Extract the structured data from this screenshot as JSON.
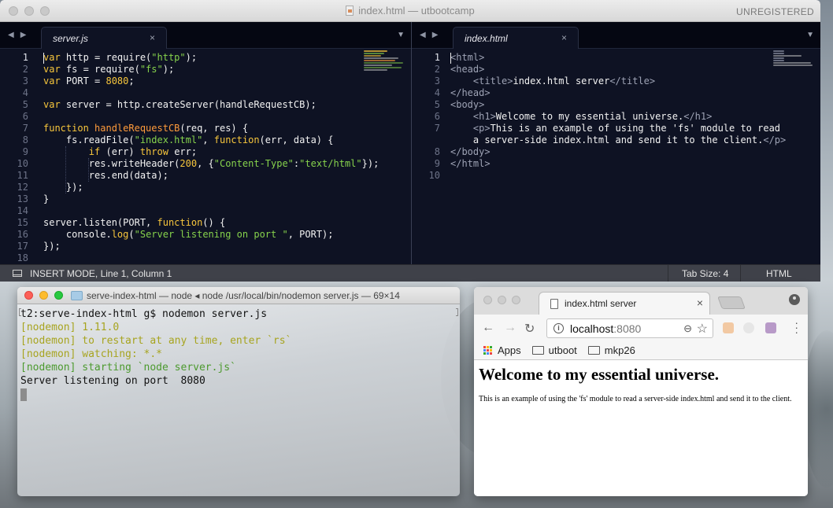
{
  "editor": {
    "window_title": "index.html — utbootcamp",
    "unregistered_label": "UNREGISTERED",
    "left_tab": "server.js",
    "right_tab": "index.html",
    "tab_close": "×",
    "left_lines": [
      [
        {
          "t": "var ",
          "c": "kw"
        },
        {
          "t": "http = require(",
          "c": ""
        },
        {
          "t": "\"http\"",
          "c": "str"
        },
        {
          "t": ");",
          "c": ""
        }
      ],
      [
        {
          "t": "var ",
          "c": "kw"
        },
        {
          "t": "fs = require(",
          "c": ""
        },
        {
          "t": "\"fs\"",
          "c": "str"
        },
        {
          "t": ");",
          "c": ""
        }
      ],
      [
        {
          "t": "var ",
          "c": "kw"
        },
        {
          "t": "PORT = ",
          "c": ""
        },
        {
          "t": "8080",
          "c": "num"
        },
        {
          "t": ";",
          "c": ""
        }
      ],
      [],
      [
        {
          "t": "var ",
          "c": "kw"
        },
        {
          "t": "server = http.createServer(handleRequestCB);",
          "c": ""
        }
      ],
      [],
      [
        {
          "t": "function ",
          "c": "kw"
        },
        {
          "t": "handleRequestCB",
          "c": "fn"
        },
        {
          "t": "(req, res) {",
          "c": ""
        }
      ],
      [
        {
          "t": "    fs.readFile(",
          "c": ""
        },
        {
          "t": "\"index.html\"",
          "c": "str"
        },
        {
          "t": ", ",
          "c": ""
        },
        {
          "t": "function",
          "c": "kw"
        },
        {
          "t": "(err, data) {",
          "c": ""
        }
      ],
      [
        {
          "t": "        ",
          "c": ""
        },
        {
          "t": "if ",
          "c": "kw"
        },
        {
          "t": "(err) ",
          "c": ""
        },
        {
          "t": "throw ",
          "c": "kw"
        },
        {
          "t": "err;",
          "c": ""
        }
      ],
      [
        {
          "t": "        res.writeHeader(",
          "c": ""
        },
        {
          "t": "200",
          "c": "num"
        },
        {
          "t": ", {",
          "c": ""
        },
        {
          "t": "\"Content-Type\"",
          "c": "str"
        },
        {
          "t": ":",
          "c": ""
        },
        {
          "t": "\"text/html\"",
          "c": "str"
        },
        {
          "t": "});",
          "c": ""
        }
      ],
      [
        {
          "t": "        res.end(data);",
          "c": ""
        }
      ],
      [
        {
          "t": "    });",
          "c": ""
        }
      ],
      [
        {
          "t": "}",
          "c": ""
        }
      ],
      [],
      [
        {
          "t": "server.listen(PORT, ",
          "c": ""
        },
        {
          "t": "function",
          "c": "kw"
        },
        {
          "t": "() {",
          "c": ""
        }
      ],
      [
        {
          "t": "    console.",
          "c": ""
        },
        {
          "t": "log",
          "c": "kw"
        },
        {
          "t": "(",
          "c": ""
        },
        {
          "t": "\"Server listening on port \"",
          "c": "str"
        },
        {
          "t": ", PORT);",
          "c": ""
        }
      ],
      [
        {
          "t": "});",
          "c": ""
        }
      ],
      []
    ],
    "left_line_numbers": [
      "1",
      "2",
      "3",
      "4",
      "5",
      "6",
      "7",
      "8",
      "9",
      "10",
      "11",
      "12",
      "13",
      "14",
      "15",
      "16",
      "17",
      "18"
    ],
    "right_lines": [
      [
        {
          "t": "<html>",
          "c": "tag"
        }
      ],
      [
        {
          "t": "<head>",
          "c": "tag"
        }
      ],
      [
        {
          "t": "    <title>",
          "c": "tag"
        },
        {
          "t": "index.html server",
          "c": ""
        },
        {
          "t": "</title>",
          "c": "tag"
        }
      ],
      [
        {
          "t": "</head>",
          "c": "tag"
        }
      ],
      [
        {
          "t": "<body>",
          "c": "tag"
        }
      ],
      [
        {
          "t": "    <h1>",
          "c": "tag"
        },
        {
          "t": "Welcome to my essential universe.",
          "c": ""
        },
        {
          "t": "</h1>",
          "c": "tag"
        }
      ],
      [
        {
          "t": "    <p>",
          "c": "tag"
        },
        {
          "t": "This is an example of using the 'fs' module to read",
          "c": ""
        }
      ],
      [
        {
          "t": "    a server-side index.html and send it to the client.",
          "c": ""
        },
        {
          "t": "</p>",
          "c": "tag"
        }
      ],
      [
        {
          "t": "</body>",
          "c": "tag"
        }
      ],
      [
        {
          "t": "</html>",
          "c": "tag"
        }
      ],
      []
    ],
    "right_line_numbers": [
      "1",
      "2",
      "3",
      "4",
      "5",
      "6",
      "7",
      "",
      "8",
      "9",
      "10"
    ],
    "status": {
      "mode": "INSERT MODE, Line 1, Column 1",
      "tab_size": "Tab Size: 4",
      "syntax": "HTML"
    },
    "colors": {
      "background": "#0e1223",
      "keyword": "#f7c63c",
      "string": "#86d24c",
      "function": "#ff9b3b"
    }
  },
  "terminal": {
    "title": "serve-index-html — node ◂ node /usr/local/bin/nodemon server.js — 69×14",
    "lines": [
      {
        "text": "t2:serve-index-html g$ nodemon server.js",
        "style": ""
      },
      {
        "text": "[nodemon] 1.11.0",
        "style": "nm"
      },
      {
        "text": "[nodemon] to restart at any time, enter `rs`",
        "style": "nm"
      },
      {
        "text": "[nodemon] watching: *.*",
        "style": "nm"
      },
      {
        "text": "[nodemon] starting `node server.js`",
        "style": "nm-green"
      },
      {
        "text": "Server listening on port  8080",
        "style": ""
      }
    ]
  },
  "browser": {
    "tab_title": "index.html server",
    "tab_close": "×",
    "url_host": "localhost",
    "url_port": ":8080",
    "bookmarks": [
      "Apps",
      "utboot",
      "mkp26"
    ],
    "page": {
      "heading": "Welcome to my essential universe.",
      "paragraph": "This is an example of using the 'fs' module to read a server-side index.html and send it to the client."
    }
  }
}
